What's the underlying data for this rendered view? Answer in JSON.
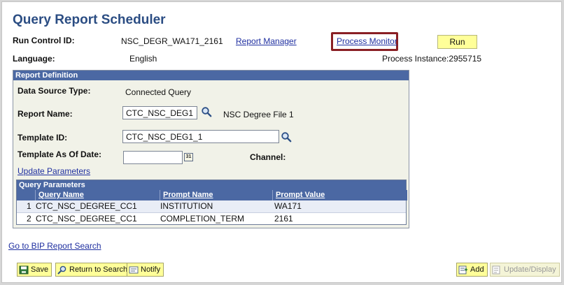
{
  "page": {
    "title": "Query Report Scheduler",
    "run_control_label": "Run Control ID:",
    "run_control_value": "NSC_DEGR_WA171_2161",
    "report_manager_link": "Report Manager",
    "process_monitor_link": "Process Monitor",
    "run_button": "Run",
    "language_label": "Language:",
    "language_value": "English",
    "process_instance": "Process Instance:2955715"
  },
  "report_definition": {
    "header": "Report Definition",
    "data_source_label": "Data Source Type:",
    "data_source_value": "Connected Query",
    "report_name_label": "Report Name:",
    "report_name_value": "CTC_NSC_DEG1",
    "report_name_desc": "NSC Degree File 1",
    "template_id_label": "Template ID:",
    "template_id_value": "CTC_NSC_DEG1_1",
    "template_date_label": "Template As Of Date:",
    "template_date_value": "",
    "channel_label": "Channel:",
    "update_parameters_link": "Update Parameters",
    "calendar_glyph": "31"
  },
  "query_parameters": {
    "header": "Query Parameters",
    "columns": [
      "Query Name",
      "Prompt Name",
      "Prompt Value"
    ],
    "rows": [
      {
        "num": "1",
        "query": "CTC_NSC_DEGREE_CC1",
        "prompt": "INSTITUTION",
        "value": "WA171"
      },
      {
        "num": "2",
        "query": "CTC_NSC_DEGREE_CC1",
        "prompt": "COMPLETION_TERM",
        "value": "2161"
      }
    ]
  },
  "links": {
    "bip_search": "Go to BIP Report Search"
  },
  "toolbar": {
    "save": "Save",
    "return_to_search": "Return to Search",
    "notify": "Notify",
    "add": "Add",
    "update_display": "Update/Display"
  },
  "colors": {
    "title": "#2b4d83",
    "section_header": "#4b68a3",
    "button_yellow": "#ffff99",
    "highlight_border": "#8a1f24",
    "link": "#1f2fa0"
  }
}
